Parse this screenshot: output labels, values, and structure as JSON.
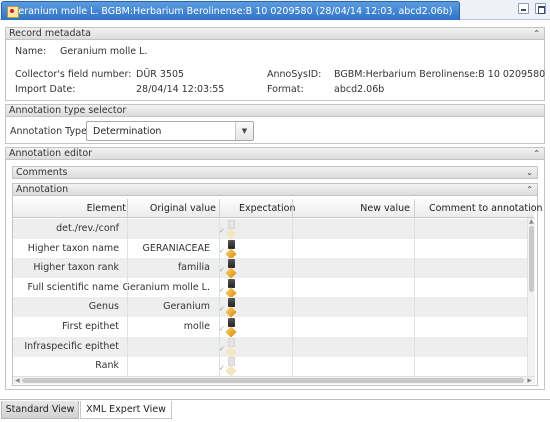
{
  "window": {
    "title": "Geranium molle L. BGBM:Herbarium Berolinense:B 10 0209580 (28/04/14 12:03, abcd2.06b)"
  },
  "metadata_panel": {
    "title": "Record metadata",
    "name_label": "Name:",
    "name_value": "Geranium molle L.",
    "collector_label": "Collector's field number:",
    "collector_value": "DÜR 3505",
    "annosys_label": "AnnoSysID:",
    "annosys_value": "BGBM:Herbarium Berolinense:B 10 0209580",
    "import_label": "Import Date:",
    "import_value": "28/04/14 12:03:55",
    "format_label": "Format:",
    "format_value": "abcd2.06b"
  },
  "type_selector_panel": {
    "title": "Annotation type selector",
    "type_label": "Annotation Type:",
    "type_value": "Determination"
  },
  "editor_panel": {
    "title": "Annotation editor",
    "comments_title": "Comments",
    "annotation_title": "Annotation"
  },
  "grid": {
    "columns": [
      "Element",
      "Original value",
      "Expectation",
      "New value",
      "Comment to annotation"
    ],
    "rows": [
      {
        "element": "det./rev./conf",
        "original": "",
        "icon_state": "light"
      },
      {
        "element": "Higher taxon name",
        "original": "GERANIACEAE",
        "icon_state": "dark"
      },
      {
        "element": "Higher taxon rank",
        "original": "familia",
        "icon_state": "dark"
      },
      {
        "element": "Full scientific name",
        "original": "Geranium molle L.",
        "icon_state": "dark"
      },
      {
        "element": "Genus",
        "original": "Geranium",
        "icon_state": "dark"
      },
      {
        "element": "First epithet",
        "original": "molle",
        "icon_state": "dark"
      },
      {
        "element": "Infraspecific epithet",
        "original": "",
        "icon_state": "light"
      },
      {
        "element": "Rank",
        "original": "",
        "icon_state": "light"
      }
    ]
  },
  "bottom_tabs": {
    "standard": "Standard View",
    "xml": "XML Expert View"
  },
  "icons": {
    "expand_collapse": "double-chevron-icon",
    "check": "check-icon",
    "delete": "trash-icon",
    "edit": "pencil-icon"
  },
  "colors": {
    "title_tab": "#2f73c6",
    "pencil": "#e19a1d"
  }
}
